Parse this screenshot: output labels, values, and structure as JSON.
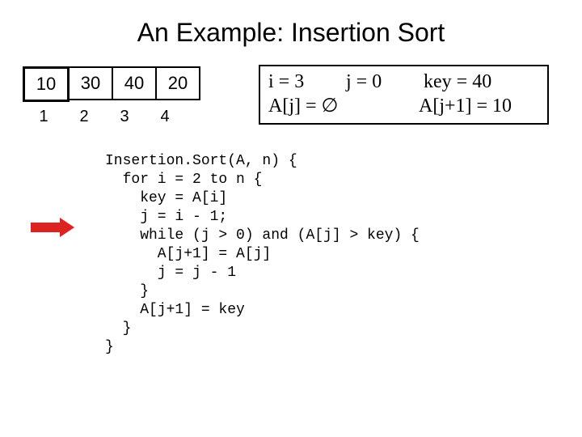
{
  "title": "An Example: Insertion Sort",
  "array": {
    "v0": "10",
    "v1": "30",
    "v2": "40",
    "v3": "20"
  },
  "index": {
    "i0": "1",
    "i1": "2",
    "i2": "3",
    "i3": "4"
  },
  "state": {
    "i": "i = 3",
    "j": "j = 0",
    "key": "key = 40",
    "aj": "A[j] = ∅",
    "ajp1": "A[j+1] = 10"
  },
  "code": "Insertion.Sort(A, n) {\n  for i = 2 to n {\n    key = A[i]\n    j = i - 1;\n    while (j > 0) and (A[j] > key) {\n      A[j+1] = A[j]\n      j = j - 1\n    }\n    A[j+1] = key\n  }\n}"
}
